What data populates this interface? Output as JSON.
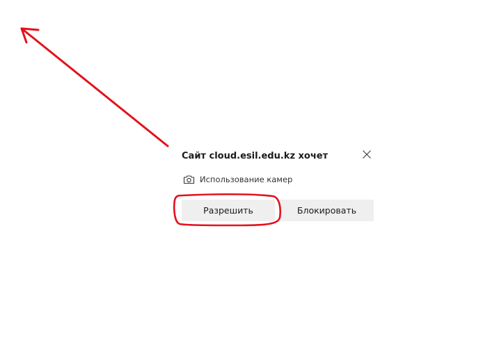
{
  "prompt": {
    "title": "Сайт cloud.esil.edu.kz хочет",
    "permission": {
      "icon": "camera-icon",
      "label": "Использование камер"
    },
    "close_icon": "close-icon",
    "allow_label": "Разрешить",
    "block_label": "Блокировать"
  },
  "annotation": {
    "color": "#e3111b",
    "shapes": [
      "arrow-icon",
      "highlight-circle"
    ]
  }
}
